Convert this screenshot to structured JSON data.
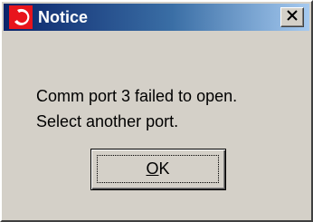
{
  "window": {
    "title": "Notice",
    "app_icon": "red-crescent-icon",
    "close_icon": "close-x-icon"
  },
  "message": {
    "line1": "Comm port 3 failed to open.",
    "line2": "Select another port."
  },
  "buttons": {
    "ok_mnemonic": "O",
    "ok_rest": "K"
  },
  "colors": {
    "dialog_face": "#d4d0c8",
    "titlebar_start": "#0a246a",
    "titlebar_end": "#a6caf0",
    "icon_red": "#e8141c"
  }
}
